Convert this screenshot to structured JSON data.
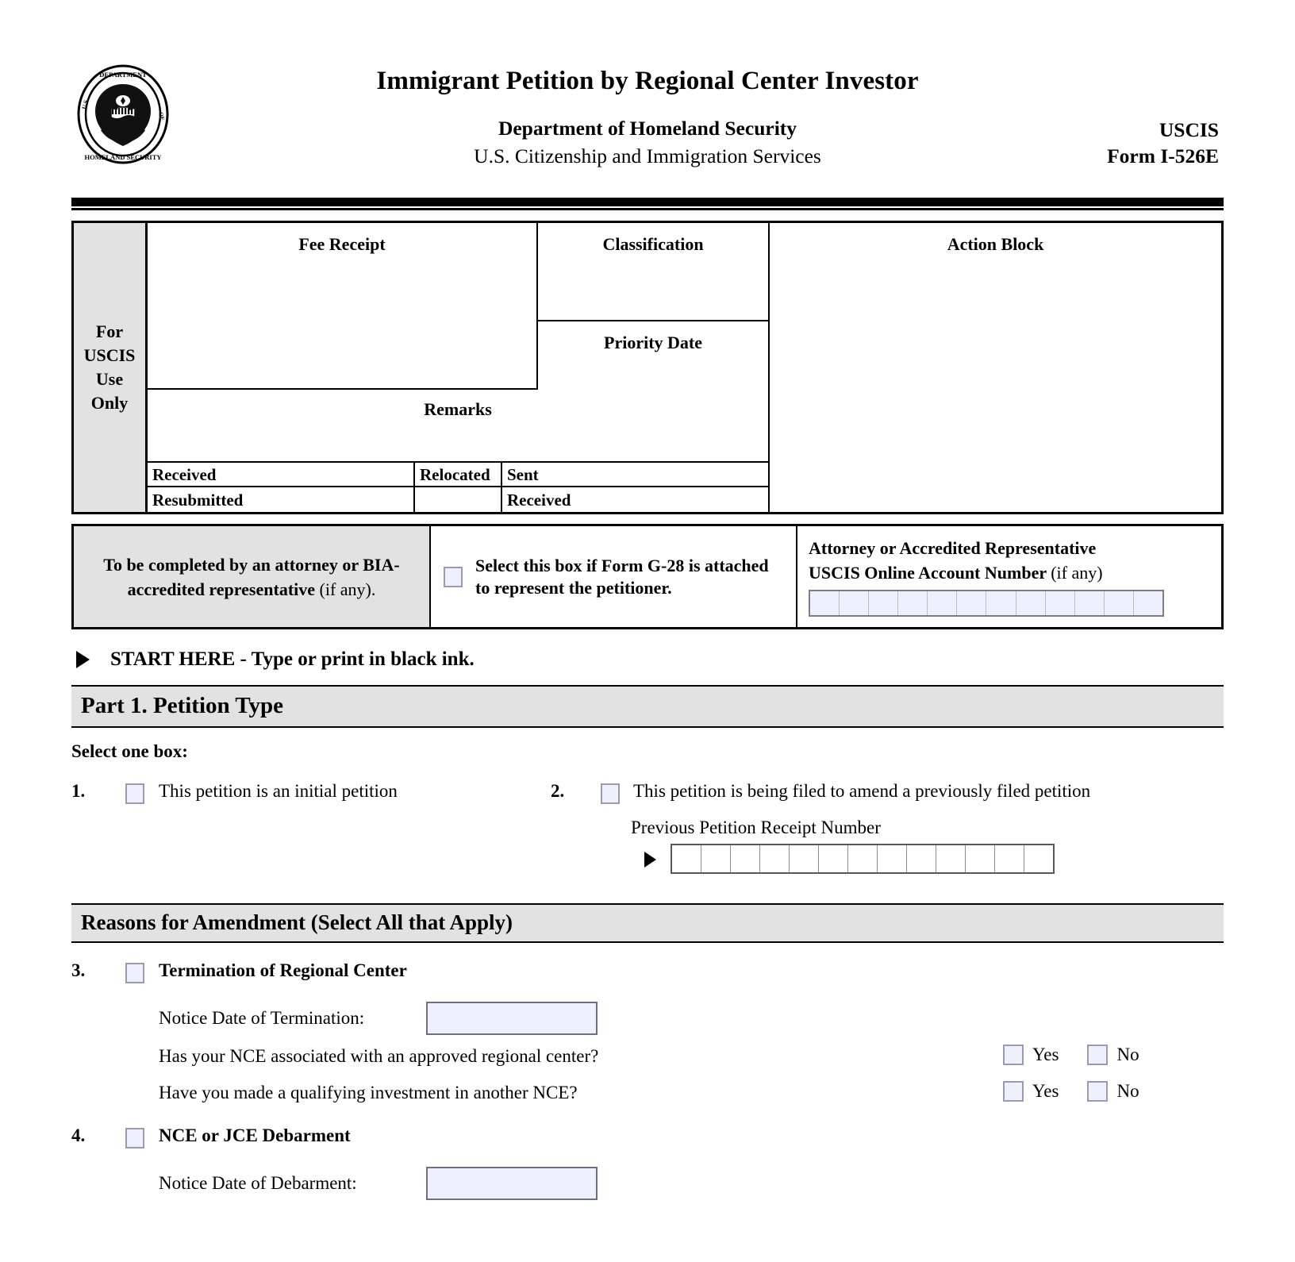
{
  "header": {
    "title": "Immigrant Petition by Regional Center Investor",
    "dept_line1": "Department of Homeland Security",
    "dept_line2": "U.S. Citizenship and Immigration Services",
    "agency": "USCIS",
    "form_number": "Form I-526E",
    "seal_text": "U.S. DEPARTMENT OF HOMELAND SECURITY"
  },
  "uscis_use": {
    "side_label": "For\nUSCIS\nUse\nOnly",
    "side_label_lines": [
      "For",
      "USCIS",
      "Use",
      "Only"
    ],
    "fee_receipt": "Fee Receipt",
    "classification": "Classification",
    "priority_date": "Priority Date",
    "action_block": "Action Block",
    "remarks": "Remarks",
    "received": "Received",
    "relocated": "Relocated",
    "sent": "Sent",
    "resubmitted": "Resubmitted",
    "received2": "Received"
  },
  "attorney": {
    "left_bold": "To be completed by an attorney or BIA-accredited representative",
    "left_reg": "(if any).",
    "g28_text": "Select this box if Form G-28 is attached to represent the petitioner.",
    "right_line1": "Attorney or Accredited Representative",
    "right_line2_bold": "USCIS Online Account Number",
    "right_line2_reg": "(if any)",
    "account_cells": 12
  },
  "start_here": "START HERE - Type or print in black ink.",
  "part1": {
    "heading": "Part 1.  Petition Type",
    "select_one": "Select one box:",
    "item1": {
      "number": "1.",
      "label": "This petition is an initial petition"
    },
    "item2": {
      "number": "2.",
      "label": "This petition is being filed to amend a previously filed petition",
      "receipt_label": "Previous Petition Receipt Number",
      "receipt_cells": 13
    }
  },
  "amendment": {
    "heading": "Reasons for Amendment (Select All that Apply)",
    "item3": {
      "number": "3.",
      "label": "Termination of Regional Center",
      "date_label": "Notice Date of Termination:",
      "questions": [
        {
          "text": "Has your NCE associated with an approved regional center?",
          "yes": "Yes",
          "no": "No"
        },
        {
          "text": "Have you made a qualifying investment in another NCE?",
          "yes": "Yes",
          "no": "No"
        }
      ]
    },
    "item4": {
      "number": "4.",
      "label": "NCE or JCE Debarment",
      "date_label": "Notice Date of Debarment:"
    }
  },
  "colors": {
    "field_fill": "#eef0fb",
    "field_border": "#9a9ab0",
    "shaded_panel": "#e2e2e2",
    "rule": "#000000"
  }
}
